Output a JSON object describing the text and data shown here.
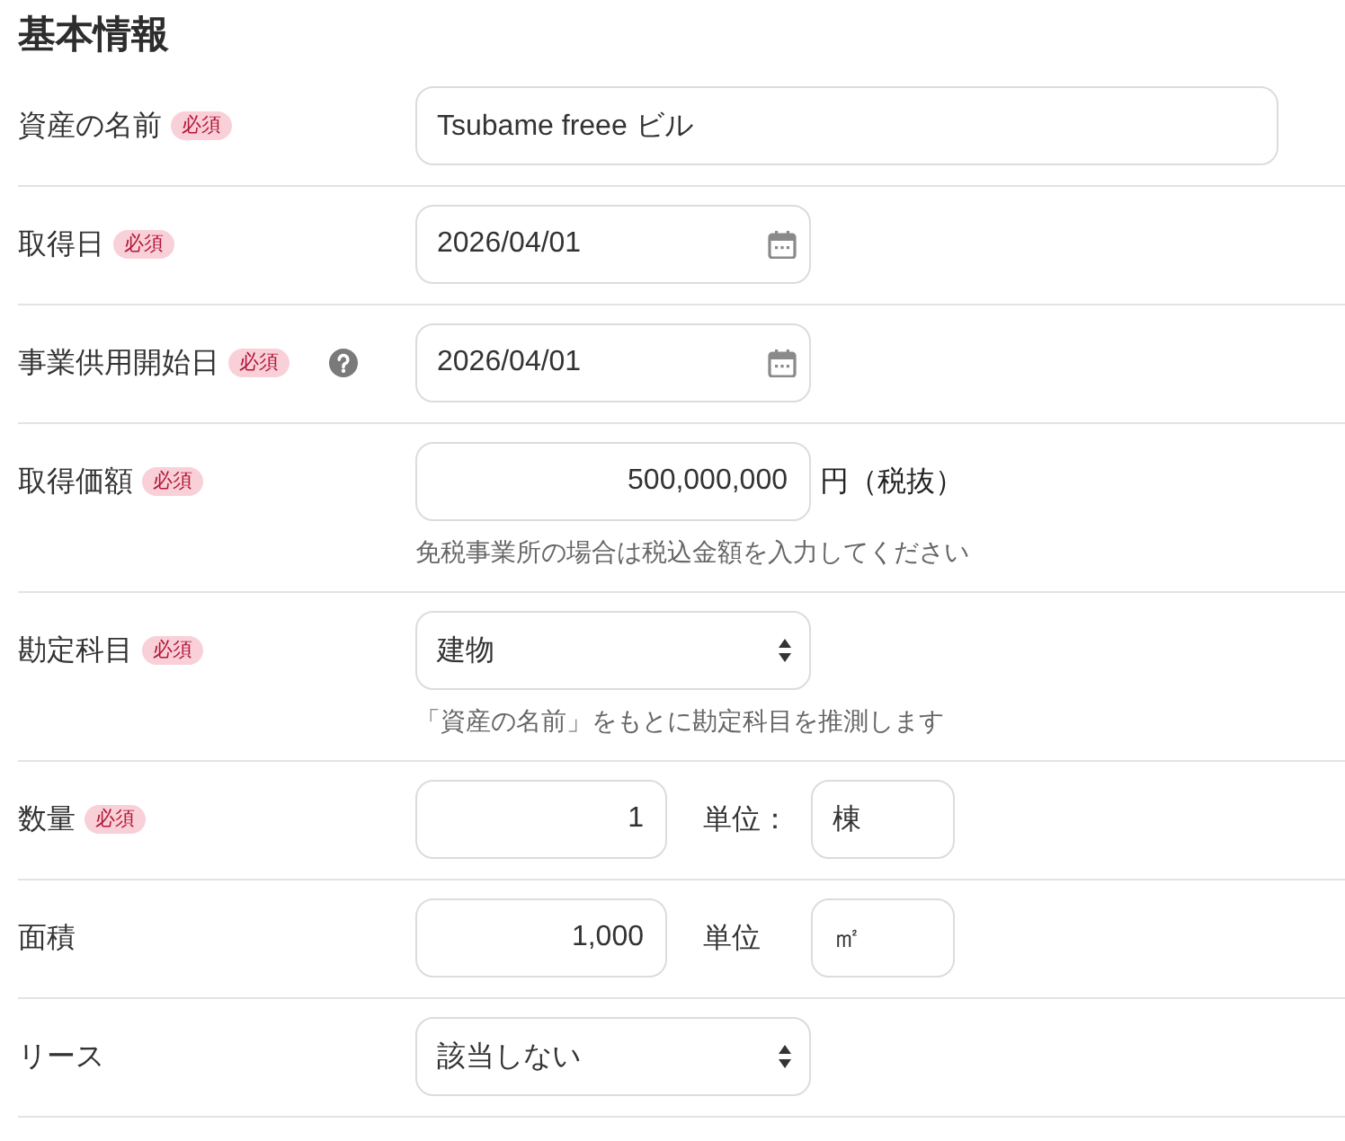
{
  "section_title": "基本情報",
  "rows": [
    {
      "label": "資産の名前",
      "badge": "必須",
      "help": false,
      "field": {
        "kind": "text",
        "value": "Tsubame freee ビル"
      }
    },
    {
      "label": "取得日",
      "badge": "必須",
      "help": false,
      "field": {
        "kind": "date",
        "value": "2026/04/01"
      }
    },
    {
      "label": "事業供用開始日",
      "badge": "必須",
      "help": true,
      "field": {
        "kind": "date",
        "value": "2026/04/01"
      }
    },
    {
      "label": "取得価額",
      "badge": "必須",
      "help": false,
      "field": {
        "kind": "amount",
        "value": "500,000,000",
        "suffix": "円（税抜）"
      },
      "hint": "免税事業所の場合は税込金額を入力してください"
    },
    {
      "label": "勘定科目",
      "badge": "必須",
      "help": false,
      "field": {
        "kind": "select",
        "value": "建物"
      },
      "hint": "「資産の名前」をもとに勘定科目を推測します"
    },
    {
      "label": "数量",
      "badge": "必須",
      "help": false,
      "field": {
        "kind": "quantity",
        "value": "1",
        "unit_label": "単位：",
        "unit": "棟"
      }
    },
    {
      "label": "面積",
      "help": false,
      "field": {
        "kind": "quantity",
        "value": "1,000",
        "unit_label": "単位",
        "unit": "㎡"
      }
    },
    {
      "label": "リース",
      "help": false,
      "field": {
        "kind": "select",
        "value": "該当しない"
      }
    }
  ]
}
